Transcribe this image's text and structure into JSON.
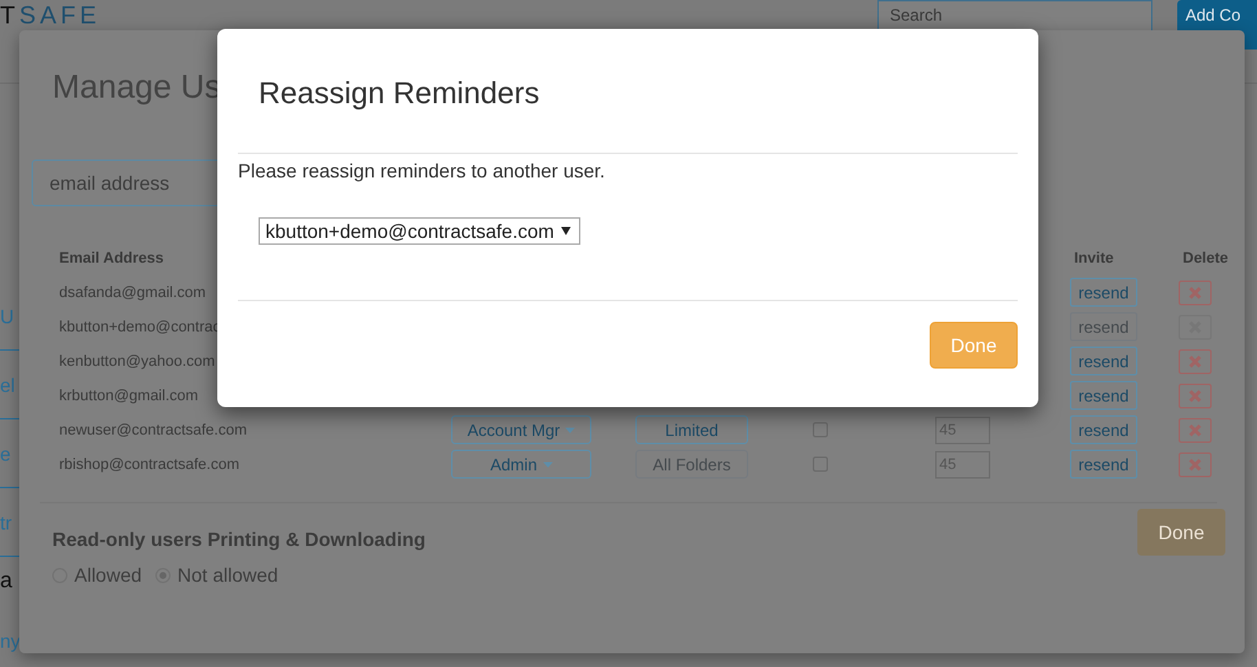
{
  "page": {
    "logo": {
      "dark": "T",
      "light": "SAFE"
    },
    "search": {
      "placeholder": "Search"
    },
    "add_button": "Add Co",
    "side_links": [
      {
        "label": "U",
        "kind": "link"
      },
      {
        "label": "el",
        "kind": "link"
      },
      {
        "label": "e",
        "kind": "link"
      },
      {
        "label": "tr",
        "kind": "link"
      },
      {
        "label": "a",
        "kind": "heading"
      },
      {
        "label": "ny",
        "kind": "link"
      }
    ]
  },
  "manage_users": {
    "title": "Manage Us",
    "email_field": {
      "placeholder": "email address"
    },
    "columns": [
      {
        "label": "Email Address",
        "kind": "email"
      },
      {
        "label": "Invite",
        "kind": "invite"
      },
      {
        "label": "Delete",
        "kind": "delete"
      }
    ],
    "rows": [
      {
        "email": "dsafanda@gmail.com",
        "invite": {
          "label": "resend",
          "disabled": false
        },
        "delete": {
          "disabled": false
        }
      },
      {
        "email": "kbutton+demo@contrac",
        "invite": {
          "label": "resend",
          "disabled": true
        },
        "delete": {
          "disabled": true
        }
      },
      {
        "email": "kenbutton@yahoo.com",
        "invite": {
          "label": "resend",
          "disabled": false
        },
        "delete": {
          "disabled": false
        }
      },
      {
        "email": "krbutton@gmail.com",
        "invite": {
          "label": "resend",
          "disabled": false
        },
        "delete": {
          "disabled": false
        }
      },
      {
        "email": "newuser@contractsafe.com",
        "role": "Account Mgr",
        "folders": {
          "label": "Limited",
          "disabled": false
        },
        "restricted": false,
        "days": "45",
        "invite": {
          "label": "resend",
          "disabled": false
        },
        "delete": {
          "disabled": false
        }
      },
      {
        "email": "rbishop@contractsafe.com",
        "role": "Admin",
        "folders": {
          "label": "All Folders",
          "disabled": true
        },
        "restricted": false,
        "days": "45",
        "invite": {
          "label": "resend",
          "disabled": false
        },
        "delete": {
          "disabled": false
        }
      }
    ],
    "print_section": {
      "title": "Read-only users Printing & Downloading",
      "options": [
        {
          "label": "Allowed",
          "selected": false
        },
        {
          "label": "Not allowed",
          "selected": true
        }
      ]
    },
    "done_button": "Done"
  },
  "reassign_dialog": {
    "title": "Reassign Reminders",
    "message": "Please reassign reminders to another user.",
    "user_select": {
      "value": "kbutton+demo@contractsafe.com"
    },
    "done_button": "Done"
  }
}
